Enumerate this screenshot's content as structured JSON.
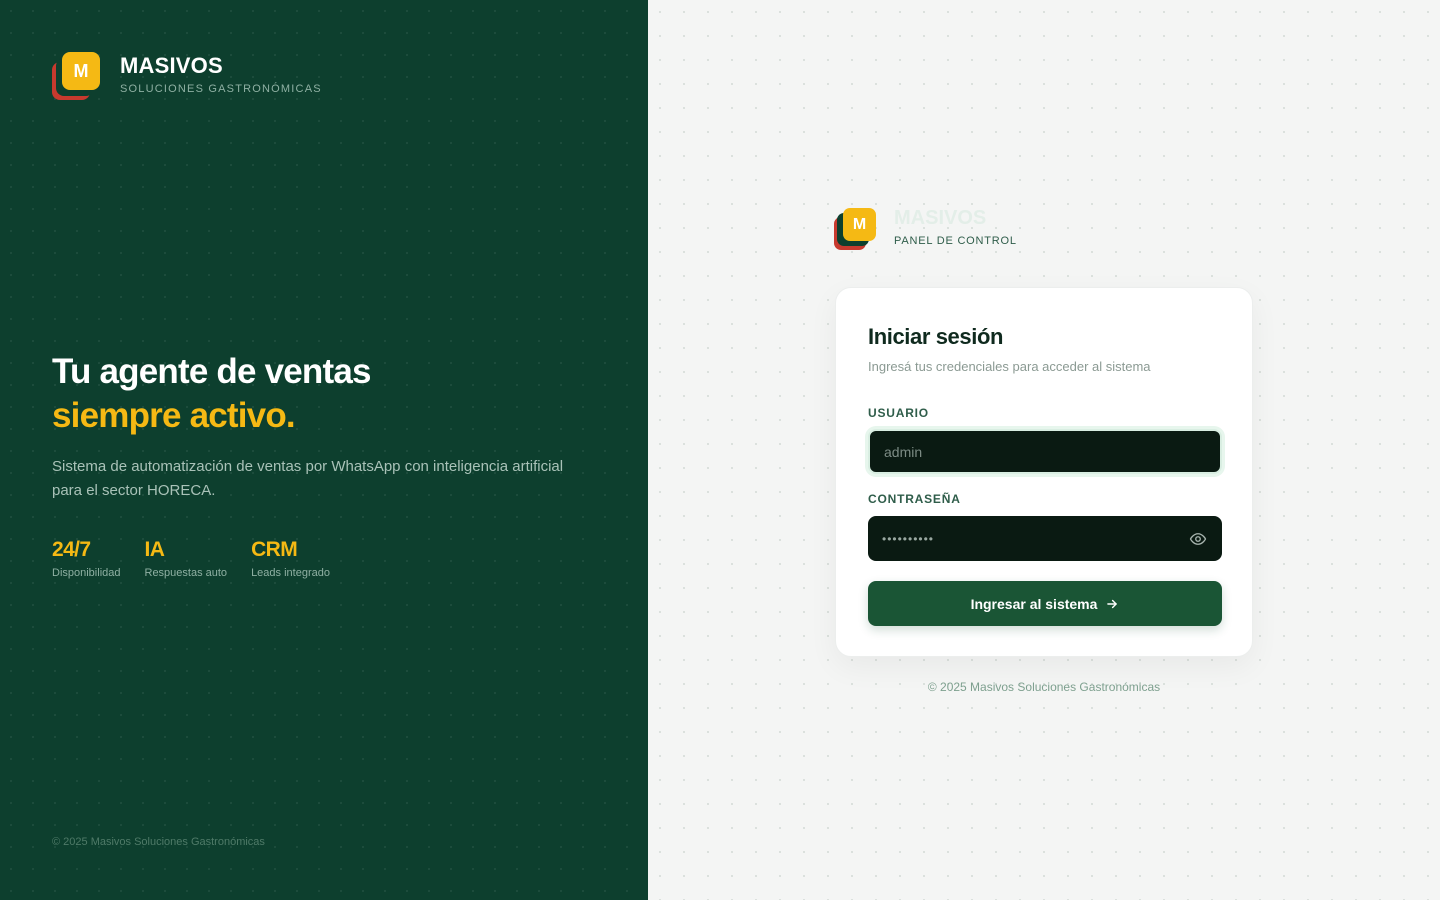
{
  "brand": {
    "logo_letter": "M",
    "name": "MASIVOS",
    "tagline": "SOLUCIONES GASTRONÓMICAS"
  },
  "hero": {
    "line1": "Tu agente de ventas",
    "line2": "siempre activo.",
    "description": "Sistema de automatización de ventas por WhatsApp con inteligencia artificial para el sector HORECA."
  },
  "stats": [
    {
      "value": "24/7",
      "label": "Disponibilidad"
    },
    {
      "value": "IA",
      "label": "Respuestas auto"
    },
    {
      "value": "CRM",
      "label": "Leads integrado"
    }
  ],
  "left_footer": "© 2025 Masivos Soluciones Gastronómicas",
  "panel": {
    "logo_letter": "M",
    "name": "MASIVOS",
    "subtitle": "PANEL DE CONTROL"
  },
  "login": {
    "title": "Iniciar sesión",
    "subtitle": "Ingresá tus credenciales para acceder al sistema",
    "username_label": "USUARIO",
    "username_value": "admin",
    "password_label": "CONTRASEÑA",
    "password_mask": "••••••••••",
    "submit_label": "Ingresar al sistema"
  },
  "right_footer": "© 2025 Masivos Soluciones Gastronómicas",
  "colors": {
    "left_bg": "#0d3f2e",
    "accent_yellow": "#f5b914",
    "logo_red": "#c73a2e",
    "button_green": "#1a5535",
    "input_bg": "#0a1a12"
  }
}
